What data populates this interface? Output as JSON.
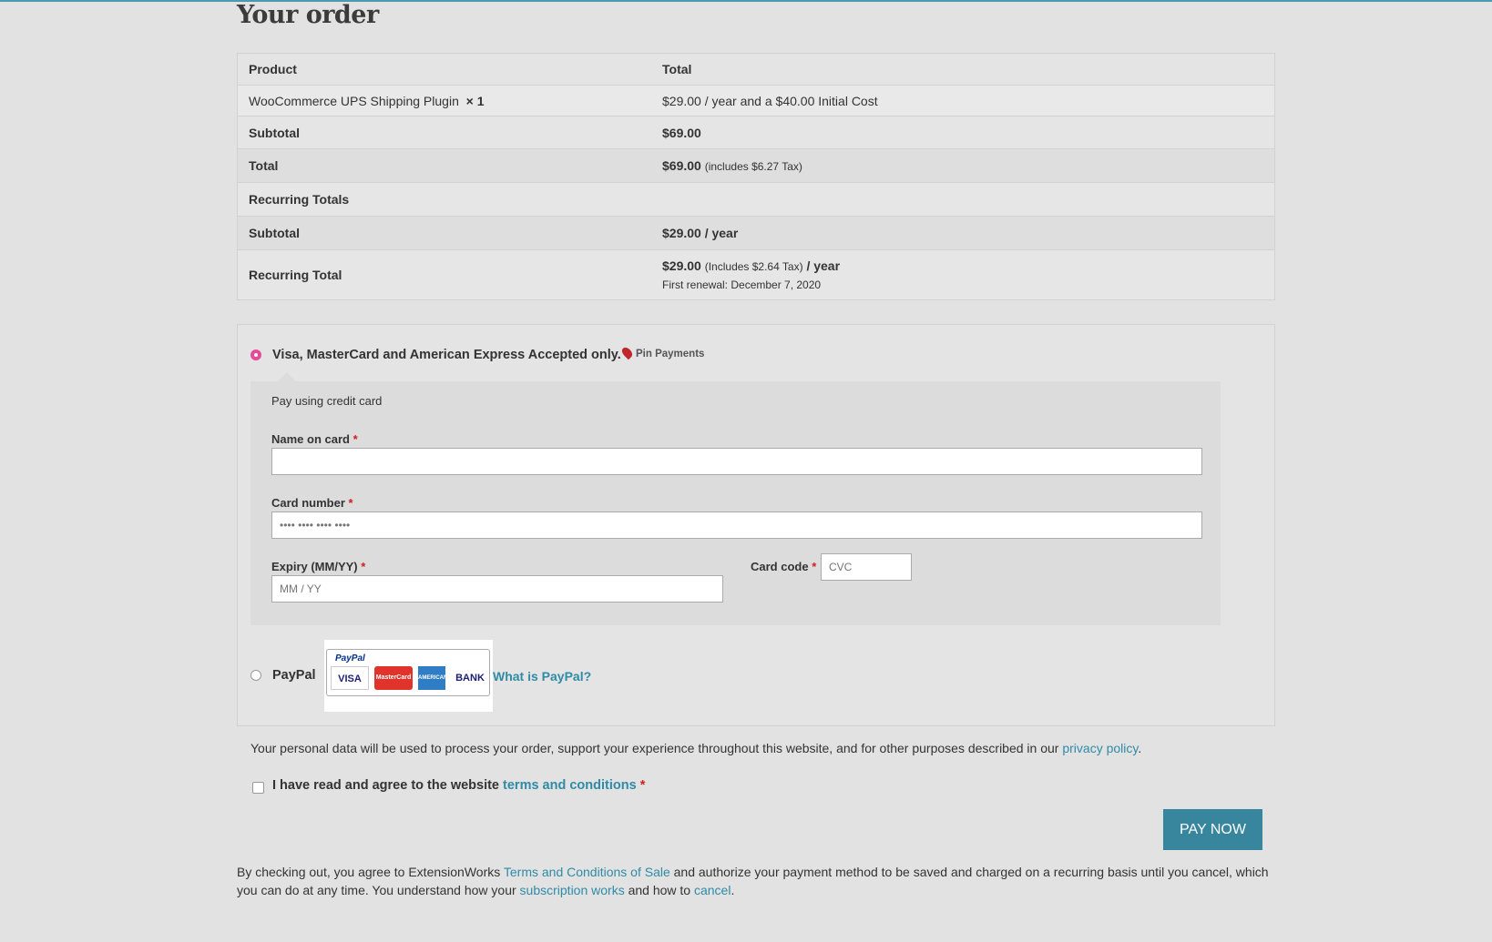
{
  "page": {
    "title": "Your order"
  },
  "order": {
    "headers": {
      "product": "Product",
      "total": "Total"
    },
    "item": {
      "name": "WooCommerce UPS Shipping Plugin",
      "qty": "× 1",
      "price": "$29.00 / year and a $40.00 Initial Cost"
    },
    "subtotal": {
      "label": "Subtotal",
      "value": "$69.00"
    },
    "total": {
      "label": "Total",
      "value": "$69.00",
      "tax": "(includes $6.27 Tax)"
    },
    "recurring_header": "Recurring Totals",
    "recurring_subtotal": {
      "label": "Subtotal",
      "value": "$29.00 / year"
    },
    "recurring_total": {
      "label": "Recurring Total",
      "value": "$29.00",
      "tax": "(Includes $2.64 Tax)",
      "period": "/ year",
      "renewal": "First renewal: December 7, 2020"
    }
  },
  "payment": {
    "card_method": {
      "label": "Visa, MasterCard and American Express Accepted only.",
      "provider": "Pin Payments",
      "selected": true
    },
    "card_description": "Pay using credit card",
    "name_label": "Name on card",
    "number_label": "Card number",
    "number_placeholder": "•••• •••• •••• ••••",
    "expiry_label": "Expiry (MM/YY)",
    "expiry_placeholder": "MM / YY",
    "code_label": "Card code",
    "code_placeholder": "CVC",
    "required_mark": "*",
    "paypal": {
      "label": "PayPal",
      "logo_text": "PayPal",
      "cards": [
        "VISA",
        "MasterCard",
        "AMERICAN EXPRESS",
        "BANK"
      ],
      "what_link": "What is PayPal?",
      "selected": false
    }
  },
  "privacy": {
    "text": "Your personal data will be used to process your order, support your experience throughout this website, and for other purposes described in our ",
    "link": "privacy policy",
    "end": "."
  },
  "terms": {
    "text": "I have read and agree to the website ",
    "link": "terms and conditions",
    "required": "*"
  },
  "pay_button": "PAY NOW",
  "footer": {
    "t1": "By checking out, you agree to ExtensionWorks ",
    "l1": "Terms and Conditions of Sale",
    "t2": " and authorize your payment method to be saved and charged on a recurring basis until you cancel, which you can do at any time. You understand how your ",
    "l2": "subscription works",
    "t3": " and how to ",
    "l3": "cancel",
    "t4": "."
  },
  "colors": {
    "accent": "#37869e",
    "link": "#2f8ba6",
    "radio_selected": "#e64b9a",
    "required": "#d02020"
  }
}
